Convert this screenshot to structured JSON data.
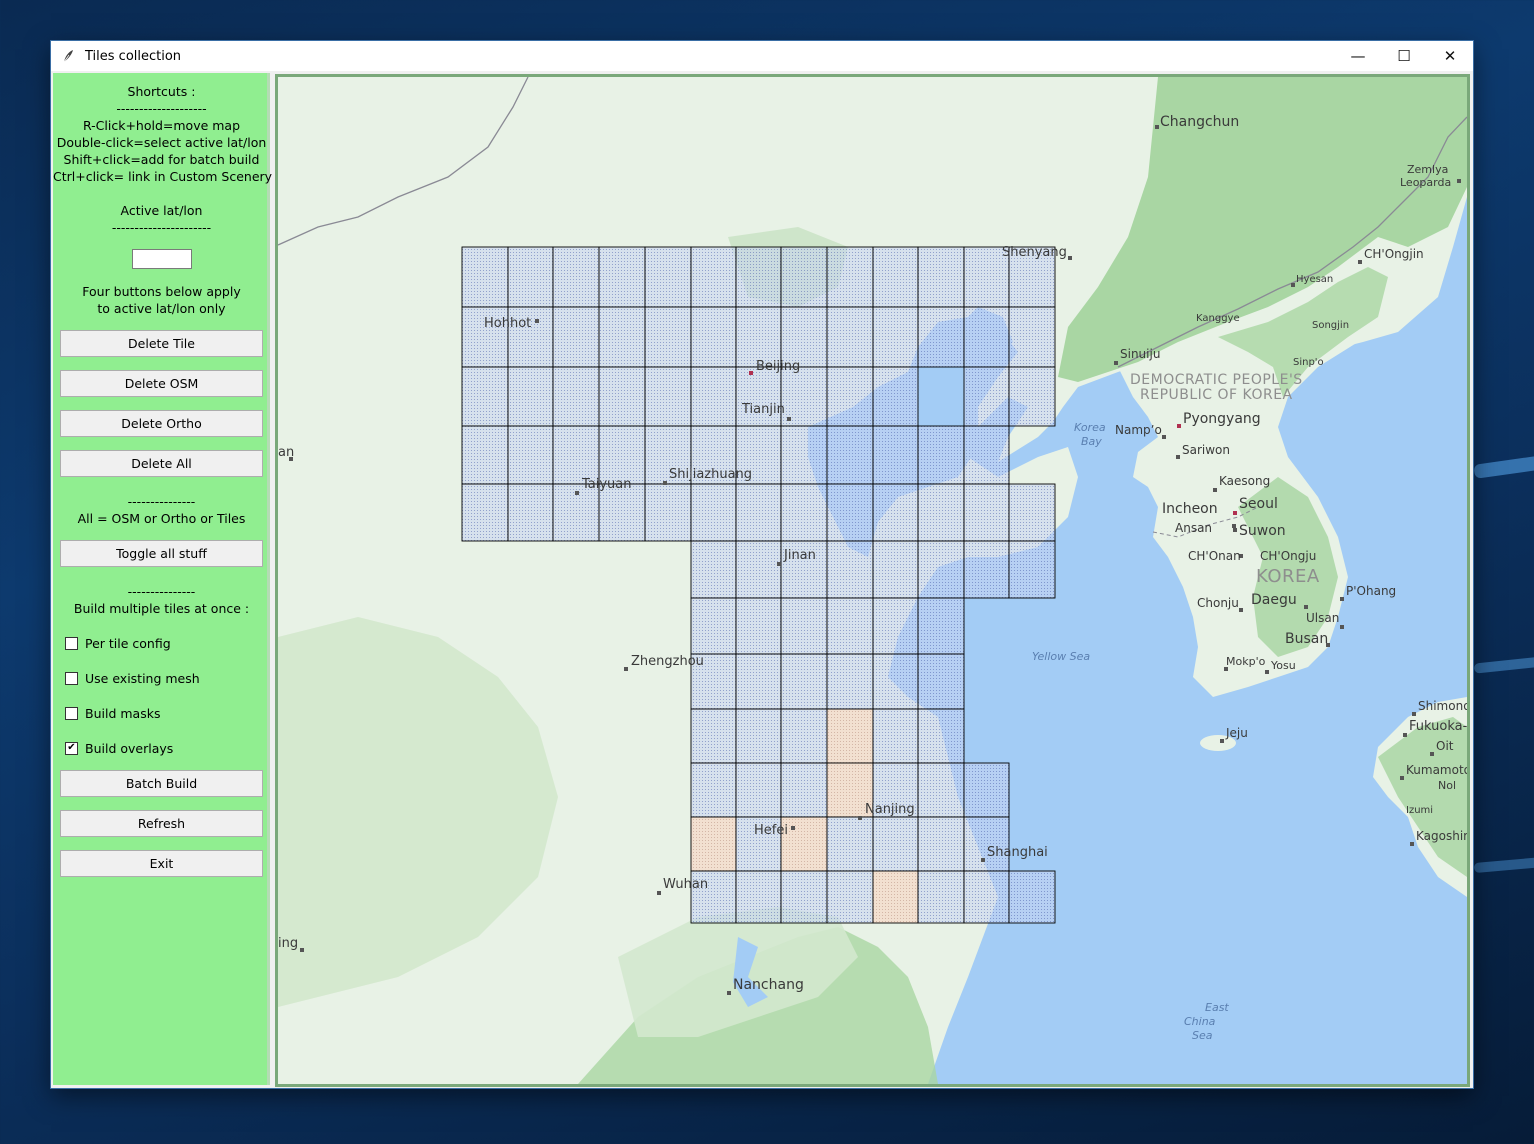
{
  "window": {
    "title": "Tiles collection",
    "controls": {
      "minimize": "—",
      "maximize": "☐",
      "close": "✕"
    }
  },
  "sidebar": {
    "shortcuts_title": "Shortcuts :",
    "separator_1": "--------------------",
    "shortcuts": [
      "R-Click+hold=move map",
      "Double-click=select active lat/lon",
      "Shift+click=add for batch build",
      "Ctrl+click= link in Custom Scenery"
    ],
    "active_latlon_title": "Active lat/lon",
    "separator_2": "----------------------",
    "active_latlon_value": "",
    "note_line1": "Four buttons below apply",
    "note_line2": "to active lat/lon only",
    "buttons": {
      "delete_tile": "Delete Tile",
      "delete_osm": "Delete OSM",
      "delete_ortho": "Delete Ortho",
      "delete_all": "Delete All",
      "toggle_all": "Toggle all stuff",
      "batch_build": "Batch Build",
      "refresh": "Refresh",
      "exit": "Exit"
    },
    "separator_3": "---------------",
    "all_note": "All = OSM or Ortho or Tiles",
    "separator_4": "---------------",
    "batch_title": "Build multiple tiles at once :",
    "checkboxes": [
      {
        "label": "Per tile config",
        "checked": false
      },
      {
        "label": "Use existing mesh",
        "checked": false
      },
      {
        "label": "Build masks",
        "checked": false
      },
      {
        "label": "Build overlays",
        "checked": true
      }
    ]
  },
  "map": {
    "colors": {
      "land": "#e8f2e6",
      "forest": "#a9d6a3",
      "sea": "#a3ccf5",
      "tile_fill": "#c6d2f2",
      "tile_ortho": "#f5dccb",
      "tile_border": "#000000"
    },
    "city_labels": [
      "Changchun",
      "Shenyang",
      "Hohhot",
      "Beijing",
      "Tianjin",
      "Shijiazhuang",
      "Taiyuan",
      "Jinan",
      "Zhengzhou",
      "Nanjing",
      "Hefei",
      "Shanghai",
      "Wuhan",
      "Nanchang",
      "Sinuiju",
      "Pyongyang",
      "Nampʼo",
      "Sariwon",
      "Kaesong",
      "Incheon",
      "Seoul",
      "Ansan",
      "Suwon",
      "CH'Onan",
      "CH'Ongju",
      "Chonju",
      "Daegu",
      "P'Ohang",
      "Ulsan",
      "Busan",
      "Mokp'o",
      "Yosu",
      "Jeju",
      "CH'Ongjin",
      "Hyesan",
      "Kanggye",
      "Songjin",
      "Sinp'o",
      "Zemlya",
      "Leoparda",
      "Shimono",
      "Fukuoka-Sh",
      "Oit",
      "Kumamoto",
      "Nol",
      "Izumi",
      "Kagoshima",
      "an",
      "ing"
    ],
    "region_labels": [
      "DEMOCRATIC PEOPLE'S",
      "REPUBLIC OF KOREA",
      "KOREA"
    ],
    "water_labels": [
      "Korea",
      "Bay",
      "Yellow Sea",
      "East",
      "China",
      "Sea"
    ]
  }
}
